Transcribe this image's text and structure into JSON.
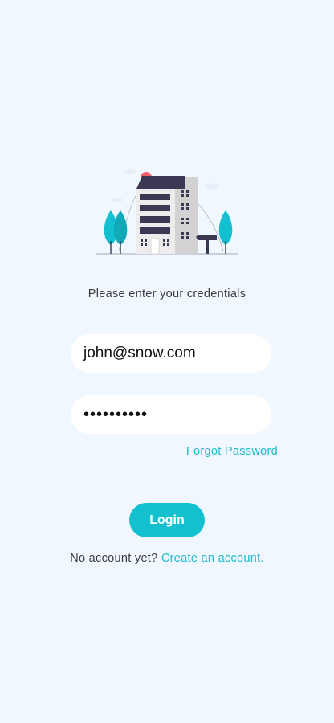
{
  "colors": {
    "background": "#f0f7ff",
    "accent": "#12c0cf",
    "link": "#1cbccc",
    "building_dark": "#3b3853",
    "building_light": "#d2d2d2",
    "sun": "#f25f6b"
  },
  "illustration": {
    "icon": "apartment-building-illustration"
  },
  "login": {
    "prompt": "Please enter your credentials",
    "email_value": "john@snow.com",
    "password_value": "••••••••••",
    "forgot_password": "Forgot Password",
    "login_button": "Login",
    "no_account_text": "No account yet?",
    "create_account_link": "Create an account."
  }
}
